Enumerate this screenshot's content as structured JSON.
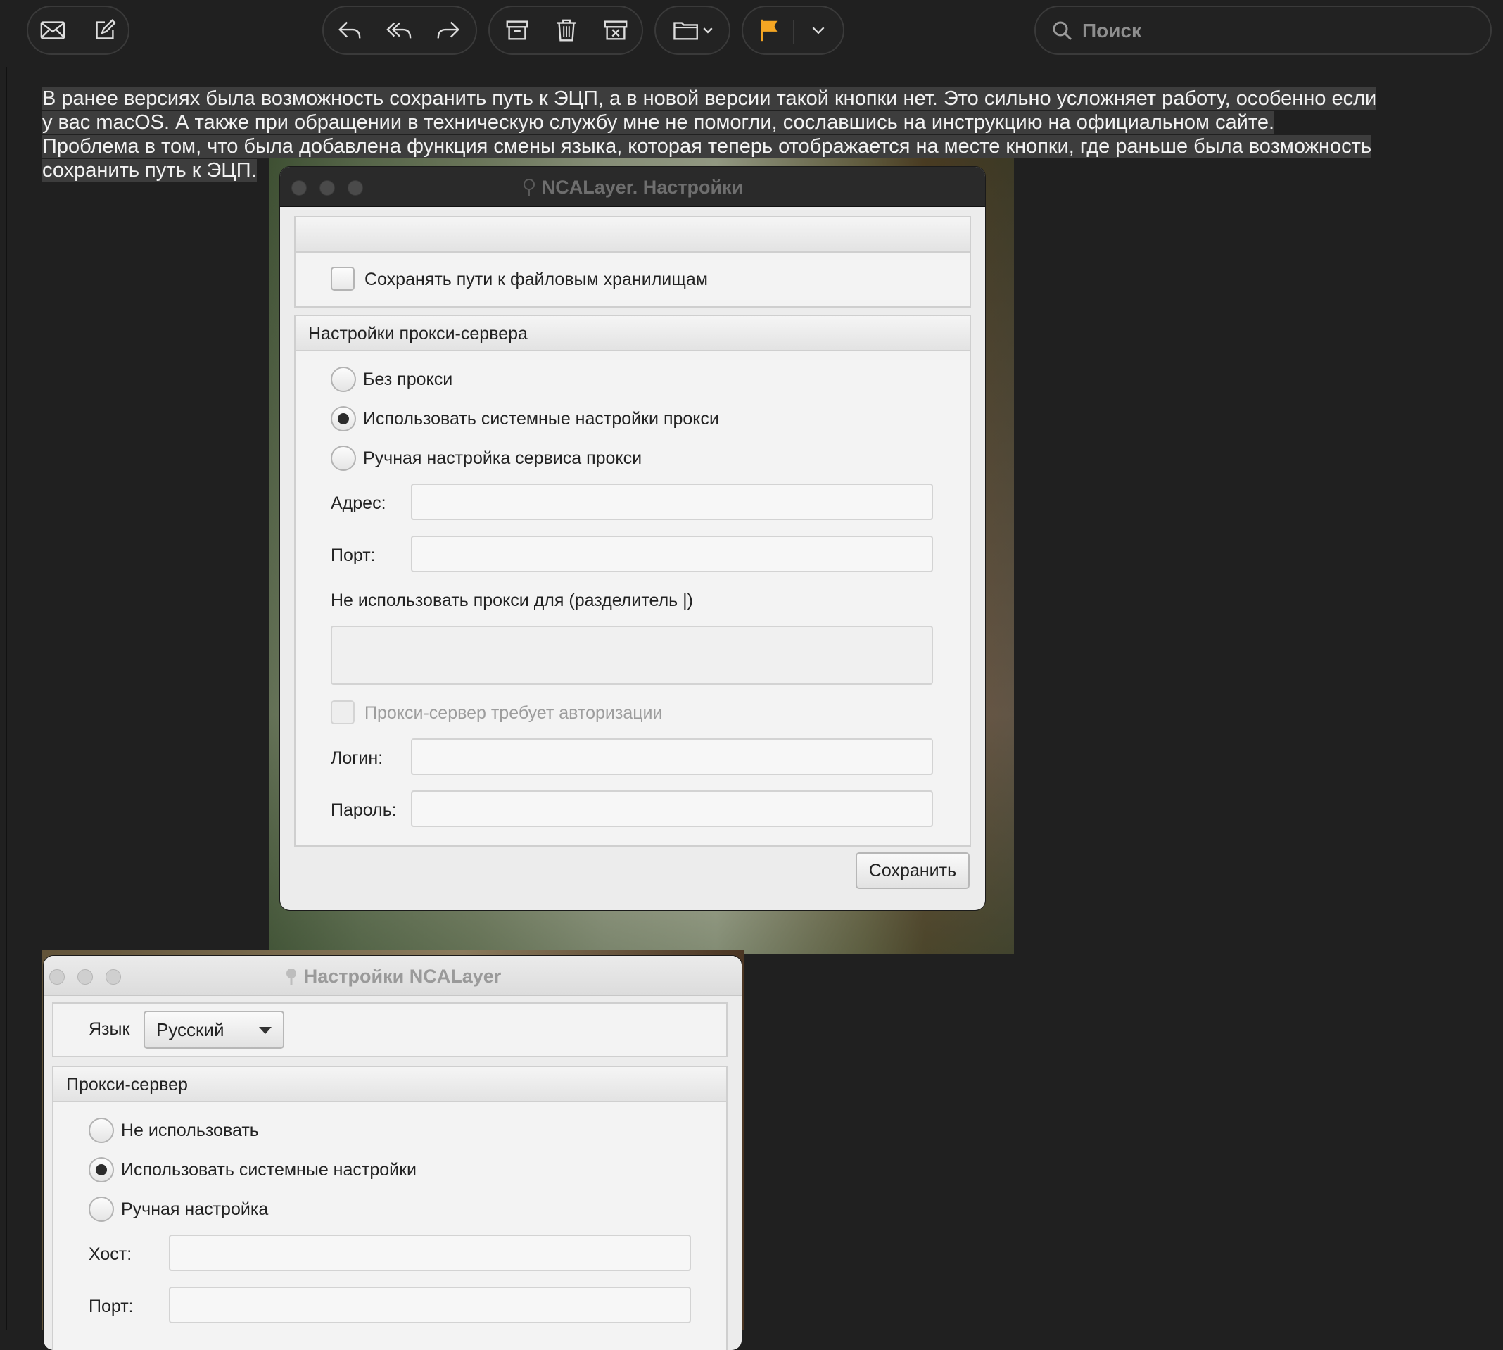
{
  "toolbar": {
    "groups": [
      {
        "icons": [
          "mail-icon",
          "compose-icon"
        ]
      },
      {
        "icons": [
          "reply-icon",
          "reply-all-icon",
          "forward-icon"
        ]
      },
      {
        "icons": [
          "archive-icon",
          "trash-icon",
          "junk-icon"
        ]
      },
      {
        "icons": [
          "folder-move-icon"
        ]
      },
      {
        "icons": [
          "flag-icon",
          "chevron-down-icon"
        ]
      }
    ],
    "flag_color": "#f5a623",
    "search_placeholder": "Поиск"
  },
  "message": {
    "lines": [
      "В ранее версиях была возможность сохранить путь к ЭЦП, а в новой версии такой кнопки нет. Это сильно усложняет работу, особенно если",
      "у вас macOS. А также при обращении в техническую службу мне не помогли, сославшись на инструкцию на официальном сайте.",
      "Проблема в том, что была добавлена функция смены языка, которая теперь отображается на месте кнопки, где раньше была возможность",
      "сохранить путь к ЭЦП."
    ]
  },
  "old_settings": {
    "title": "NCALayer. Настройки",
    "save_paths_label": "Сохранять пути к файловым хранилищам",
    "proxy_section": "Настройки прокси-сервера",
    "radio_none": "Без прокси",
    "radio_system": "Использовать системные настройки прокси",
    "radio_manual": "Ручная настройка сервиса прокси",
    "address_label": "Адрес:",
    "port_label": "Порт:",
    "no_proxy_label": "Не использовать прокси для (разделитель |)",
    "auth_label": "Прокси-сервер требует авторизации",
    "login_label": "Логин:",
    "password_label": "Пароль:",
    "save_button": "Сохранить"
  },
  "new_settings": {
    "title": "Настройки NCALayer",
    "language_label": "Язык",
    "language_value": "Русский",
    "proxy_section": "Прокси-сервер",
    "radio_none": "Не использовать",
    "radio_system": "Использовать системные настройки",
    "radio_manual": "Ручная настройка",
    "host_label": "Хост:",
    "port_label": "Порт:"
  }
}
